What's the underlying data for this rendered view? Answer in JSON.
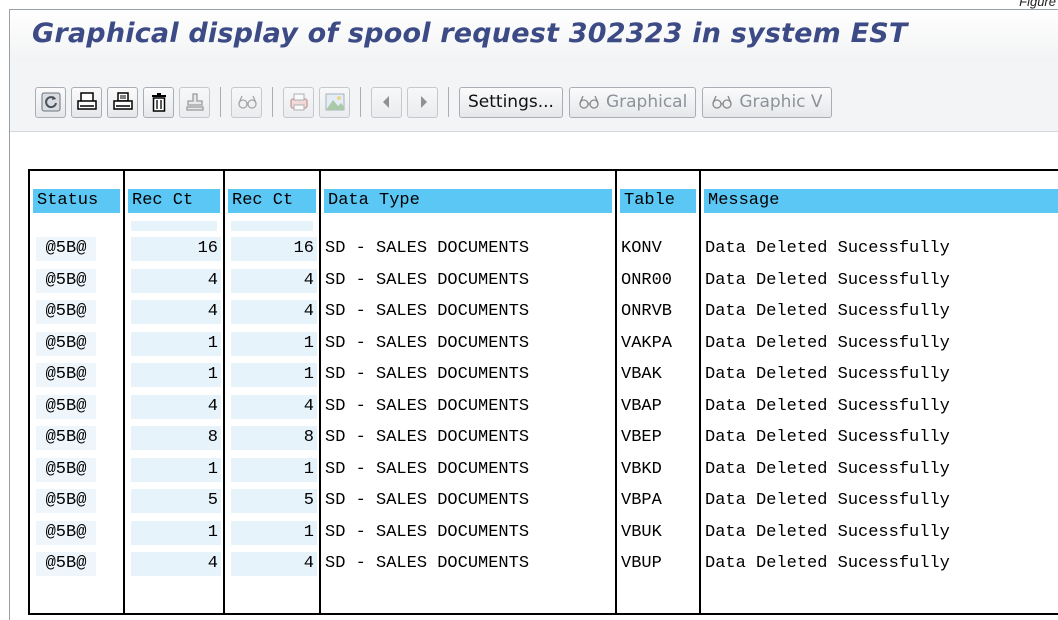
{
  "corner_label": "Figure",
  "title": "Graphical display of spool request 302323 in system EST",
  "toolbar": {
    "icons": [
      "refresh-icon",
      "print-icon",
      "print-preview-icon",
      "delete-icon",
      "stamp-icon",
      "glasses-icon",
      "print-layout-icon",
      "landscape-icon",
      "previous-page-icon",
      "next-page-icon"
    ],
    "settings_label": "Settings...",
    "graphical_label": "Graphical",
    "graphic_label": "Graphic V"
  },
  "table": {
    "columns": [
      "Status",
      "Rec Ct",
      "Rec Ct",
      "Data Type",
      "Table",
      "Message"
    ],
    "rows": [
      [
        "@5B@",
        "16",
        "16",
        "SD - SALES DOCUMENTS",
        "KONV",
        "Data Deleted Sucessfully"
      ],
      [
        "@5B@",
        "4",
        "4",
        "SD - SALES DOCUMENTS",
        "ONR00",
        "Data Deleted Sucessfully"
      ],
      [
        "@5B@",
        "4",
        "4",
        "SD - SALES DOCUMENTS",
        "ONRVB",
        "Data Deleted Sucessfully"
      ],
      [
        "@5B@",
        "1",
        "1",
        "SD - SALES DOCUMENTS",
        "VAKPA",
        "Data Deleted Sucessfully"
      ],
      [
        "@5B@",
        "1",
        "1",
        "SD - SALES DOCUMENTS",
        "VBAK",
        "Data Deleted Sucessfully"
      ],
      [
        "@5B@",
        "4",
        "4",
        "SD - SALES DOCUMENTS",
        "VBAP",
        "Data Deleted Sucessfully"
      ],
      [
        "@5B@",
        "8",
        "8",
        "SD - SALES DOCUMENTS",
        "VBEP",
        "Data Deleted Sucessfully"
      ],
      [
        "@5B@",
        "1",
        "1",
        "SD - SALES DOCUMENTS",
        "VBKD",
        "Data Deleted Sucessfully"
      ],
      [
        "@5B@",
        "5",
        "5",
        "SD - SALES DOCUMENTS",
        "VBPA",
        "Data Deleted Sucessfully"
      ],
      [
        "@5B@",
        "1",
        "1",
        "SD - SALES DOCUMENTS",
        "VBUK",
        "Data Deleted Sucessfully"
      ],
      [
        "@5B@",
        "4",
        "4",
        "SD - SALES DOCUMENTS",
        "VBUP",
        "Data Deleted Sucessfully"
      ]
    ]
  },
  "colors": {
    "title": "#3c4a85",
    "header_highlight": "#5ac7f5",
    "numeric_cell": "#e6f3fb"
  }
}
